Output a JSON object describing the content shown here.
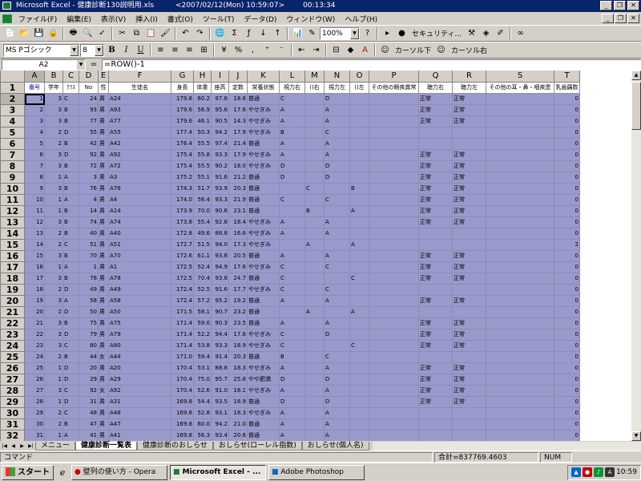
{
  "title": {
    "app": "Microsoft Excel - 健康診断130説明用.xls",
    "date": "<2007/02/12(Mon) 10:59:07>",
    "elapsed": "00:13:34"
  },
  "menu": [
    "ファイル(F)",
    "編集(E)",
    "表示(V)",
    "挿入(I)",
    "書式(O)",
    "ツール(T)",
    "データ(D)",
    "ウィンドウ(W)",
    "ヘルプ(H)"
  ],
  "toolbar": {
    "zoom": "100%",
    "security": "セキュリティ...",
    "font": "MS Pゴシック",
    "size": "8",
    "cursor_down": "カーソル下",
    "cursor_right": "カーソル右"
  },
  "formula": {
    "name_box": "A2",
    "eq": "=",
    "value": "=ROW()-1"
  },
  "grid": {
    "col_letters": [
      "A",
      "B",
      "C",
      "D",
      "E",
      "F",
      "G",
      "H",
      "I",
      "J",
      "K",
      "L",
      "M",
      "N",
      "O",
      "P",
      "Q",
      "R",
      "S",
      "T"
    ],
    "col_widths": [
      25,
      23,
      20,
      24,
      13,
      78,
      28,
      22,
      22,
      23,
      40,
      32,
      24,
      32,
      24,
      62,
      42,
      42,
      85,
      32
    ],
    "headers": [
      "番号",
      "学年",
      "ｸﾗｽ",
      "No",
      "性",
      "生徒名",
      "身長",
      "体重",
      "座高",
      "定数",
      "栄養状態",
      "視力右",
      "()右",
      "視力左",
      "()左",
      "その他の眼疾異常",
      "聴力右",
      "聴力左",
      "その他の耳・鼻・咽疾患",
      "乳歯齲数"
    ],
    "row_numbers": [
      "1",
      "2",
      "3",
      "4",
      "5",
      "6",
      "7",
      "8",
      "9",
      "10",
      "11",
      "12",
      "13",
      "14",
      "15",
      "16",
      "17",
      "18",
      "19",
      "20",
      "21",
      "22",
      "23",
      "24",
      "25",
      "26",
      "27",
      "28",
      "29",
      "30",
      "31",
      "32"
    ],
    "rows": [
      [
        "1",
        "3",
        "C",
        "24",
        "男",
        "A24",
        "179.8",
        "60.2",
        "97.8",
        "18.6",
        "普通",
        "C",
        "",
        "D",
        "",
        "",
        "正常",
        "正常",
        "",
        "0"
      ],
      [
        "2",
        "3",
        "B",
        "93",
        "男",
        "A93",
        "179.6",
        "56.9",
        "95.6",
        "17.6",
        "やせぎみ",
        "A",
        "",
        "A",
        "",
        "",
        "正常",
        "正常",
        "",
        "0"
      ],
      [
        "3",
        "3",
        "B",
        "77",
        "男",
        "A77",
        "179.6",
        "46.1",
        "90.5",
        "14.3",
        "やせぎみ",
        "A",
        "",
        "A",
        "",
        "",
        "正常",
        "正常",
        "",
        "0"
      ],
      [
        "4",
        "2",
        "D",
        "55",
        "男",
        "A55",
        "177.4",
        "50.3",
        "94.2",
        "17.9",
        "やせぎみ",
        "B",
        "",
        "C",
        "",
        "",
        "",
        "",
        "",
        "0"
      ],
      [
        "5",
        "2",
        "B",
        "42",
        "男",
        "A42",
        "176.4",
        "55.5",
        "97.4",
        "21.4",
        "普通",
        "A",
        "",
        "A",
        "",
        "",
        "",
        "",
        "",
        "0"
      ],
      [
        "6",
        "3",
        "D",
        "92",
        "男",
        "A92",
        "175.4",
        "55.8",
        "93.3",
        "17.9",
        "やせぎみ",
        "A",
        "",
        "A",
        "",
        "",
        "正常",
        "正常",
        "",
        "0"
      ],
      [
        "7",
        "3",
        "B",
        "72",
        "男",
        "A72",
        "175.4",
        "55.5",
        "90.2",
        "18.0",
        "やせぎみ",
        "D",
        "",
        "D",
        "",
        "",
        "正常",
        "正常",
        "",
        "0"
      ],
      [
        "8",
        "1",
        "A",
        "3",
        "男",
        "A3",
        "175.2",
        "55.1",
        "91.6",
        "21.2",
        "普通",
        "D",
        "",
        "D",
        "",
        "",
        "正常",
        "正常",
        "",
        "0"
      ],
      [
        "9",
        "3",
        "B",
        "76",
        "男",
        "A76",
        "174.3",
        "51.7",
        "93.9",
        "20.3",
        "普通",
        "",
        "C",
        "",
        "B",
        "",
        "正常",
        "正常",
        "",
        "0"
      ],
      [
        "10",
        "1",
        "A",
        "4",
        "男",
        "A4",
        "174.0",
        "56.4",
        "93.3",
        "21.9",
        "普通",
        "C",
        "",
        "C",
        "",
        "",
        "正常",
        "正常",
        "",
        "0"
      ],
      [
        "11",
        "1",
        "B",
        "14",
        "男",
        "A14",
        "173.9",
        "70.0",
        "90.6",
        "23.1",
        "普通",
        "",
        "B",
        "",
        "A",
        "",
        "正常",
        "正常",
        "",
        "0"
      ],
      [
        "12",
        "3",
        "B",
        "74",
        "男",
        "A74",
        "173.8",
        "55.4",
        "92.8",
        "18.4",
        "やせぎみ",
        "A",
        "",
        "A",
        "",
        "",
        "正常",
        "正常",
        "",
        "0"
      ],
      [
        "13",
        "2",
        "B",
        "40",
        "男",
        "A40",
        "172.8",
        "49.6",
        "88.8",
        "16.6",
        "やせぎみ",
        "A",
        "",
        "A",
        "",
        "",
        "",
        "",
        "",
        "0"
      ],
      [
        "14",
        "2",
        "C",
        "51",
        "男",
        "A51",
        "172.7",
        "51.5",
        "94.0",
        "17.3",
        "やせぎみ",
        "",
        "A",
        "",
        "A",
        "",
        "",
        "",
        "",
        "2"
      ],
      [
        "15",
        "3",
        "B",
        "70",
        "男",
        "A70",
        "172.6",
        "61.1",
        "93.8",
        "20.5",
        "普通",
        "A",
        "",
        "A",
        "",
        "",
        "正常",
        "正常",
        "",
        "0"
      ],
      [
        "16",
        "1",
        "A",
        "1",
        "男",
        "A1",
        "172.5",
        "52.4",
        "94.9",
        "17.6",
        "やせぎみ",
        "C",
        "",
        "C",
        "",
        "",
        "正常",
        "正常",
        "",
        "0"
      ],
      [
        "17",
        "3",
        "B",
        "78",
        "男",
        "A78",
        "172.5",
        "70.4",
        "93.8",
        "24.7",
        "普通",
        "C",
        "",
        "",
        "C",
        "",
        "正常",
        "正常",
        "",
        "0"
      ],
      [
        "18",
        "2",
        "D",
        "49",
        "男",
        "A49",
        "172.4",
        "52.5",
        "91.6",
        "17.7",
        "やせぎみ",
        "C",
        "",
        "C",
        "",
        "",
        "",
        "",
        "",
        "0"
      ],
      [
        "19",
        "3",
        "A",
        "58",
        "男",
        "A58",
        "172.4",
        "57.2",
        "95.2",
        "19.2",
        "普通",
        "A",
        "",
        "A",
        "",
        "",
        "正常",
        "正常",
        "",
        "0"
      ],
      [
        "20",
        "2",
        "D",
        "50",
        "男",
        "A50",
        "171.5",
        "58.1",
        "90.7",
        "23.2",
        "普通",
        "",
        "A",
        "",
        "A",
        "",
        "",
        "",
        "",
        "0"
      ],
      [
        "21",
        "3",
        "B",
        "75",
        "男",
        "A75",
        "171.4",
        "59.0",
        "90.3",
        "23.5",
        "普通",
        "A",
        "",
        "A",
        "",
        "",
        "正常",
        "正常",
        "",
        "0"
      ],
      [
        "22",
        "3",
        "D",
        "79",
        "男",
        "A79",
        "171.4",
        "52.2",
        "94.4",
        "17.8",
        "やせぎみ",
        "C",
        "",
        "D",
        "",
        "",
        "正常",
        "正常",
        "",
        "0"
      ],
      [
        "23",
        "3",
        "C",
        "80",
        "男",
        "A80",
        "171.4",
        "53.8",
        "93.3",
        "18.9",
        "やせぎみ",
        "C",
        "",
        "",
        "C",
        "",
        "正常",
        "正常",
        "",
        "0"
      ],
      [
        "24",
        "2",
        "B",
        "44",
        "女",
        "A44",
        "171.0",
        "59.4",
        "91.4",
        "20.3",
        "普通",
        "B",
        "",
        "C",
        "",
        "",
        "",
        "",
        "",
        "0"
      ],
      [
        "25",
        "1",
        "D",
        "20",
        "男",
        "A20",
        "170.4",
        "53.1",
        "88.8",
        "18.3",
        "やせぎみ",
        "A",
        "",
        "A",
        "",
        "",
        "正常",
        "正常",
        "",
        "0"
      ],
      [
        "26",
        "1",
        "D",
        "29",
        "男",
        "A29",
        "170.4",
        "75.0",
        "95.7",
        "25.8",
        "やや肥満",
        "D",
        "",
        "D",
        "",
        "",
        "正常",
        "正常",
        "",
        "0"
      ],
      [
        "27",
        "3",
        "C",
        "92",
        "女",
        "A92",
        "170.4",
        "52.6",
        "91.0",
        "18.1",
        "やせぎみ",
        "A",
        "",
        "A",
        "",
        "",
        "正常",
        "正常",
        "",
        "0"
      ],
      [
        "28",
        "1",
        "D",
        "31",
        "男",
        "A31",
        "169.8",
        "54.4",
        "93.5",
        "18.9",
        "普通",
        "D",
        "",
        "D",
        "",
        "",
        "正常",
        "正常",
        "",
        "0"
      ],
      [
        "29",
        "2",
        "C",
        "48",
        "男",
        "A48",
        "169.8",
        "52.8",
        "93.1",
        "18.3",
        "やせぎみ",
        "A",
        "",
        "A",
        "",
        "",
        "",
        "",
        "",
        "0"
      ],
      [
        "30",
        "2",
        "B",
        "47",
        "男",
        "A47",
        "169.8",
        "60.0",
        "94.2",
        "21.0",
        "普通",
        "A",
        "",
        "A",
        "",
        "",
        "",
        "",
        "",
        "0"
      ],
      [
        "31",
        "1",
        "A",
        "41",
        "男",
        "A41",
        "169.8",
        "56.3",
        "93.4",
        "20.6",
        "普通",
        "A",
        "",
        "A",
        "",
        "",
        "",
        "",
        "",
        "0"
      ]
    ]
  },
  "tabs": [
    "メニュー",
    "健康診断一覧表",
    "健康診断のおしらせ",
    "おしらせ(ローレル指数)",
    "おしらせ(個人名)"
  ],
  "status": {
    "mode": "コマンド",
    "sum": "合計=837769.4603",
    "num": "NUM"
  },
  "taskbar": {
    "start": "スタート",
    "tasks": [
      "壁列の使い方 - Opera",
      "Microsoft Excel - ...",
      "Adobe Photoshop"
    ],
    "clock": "10:59"
  }
}
